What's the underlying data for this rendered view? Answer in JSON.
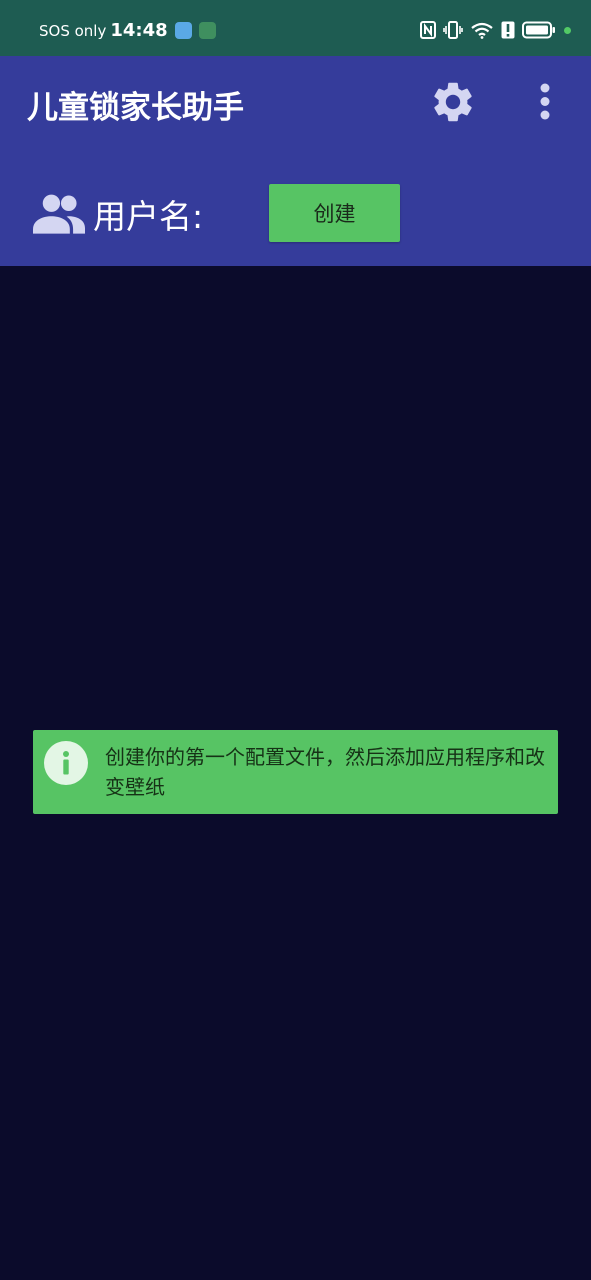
{
  "status_bar": {
    "carrier": "SOS only",
    "time": "14:48",
    "icons": [
      "app-icon-blue",
      "app-icon-green",
      "nfc-icon",
      "vibrate-icon",
      "wifi-icon",
      "alert-icon",
      "battery-icon",
      "dot-indicator"
    ]
  },
  "app_bar": {
    "title": "儿童锁家长助手",
    "settings_icon": "gear-icon",
    "menu_icon": "more-vert-icon"
  },
  "user_row": {
    "icon": "people-icon",
    "label": "用户名:",
    "create_button": "创建"
  },
  "info_banner": {
    "icon": "info-icon",
    "text": "创建你的第一个配置文件，然后添加应用程序和改变壁纸"
  },
  "colors": {
    "status_bar_bg": "#1e5c52",
    "app_bar_bg": "#353c9b",
    "page_bg": "#0b0b2b",
    "accent_green": "#57c464"
  }
}
